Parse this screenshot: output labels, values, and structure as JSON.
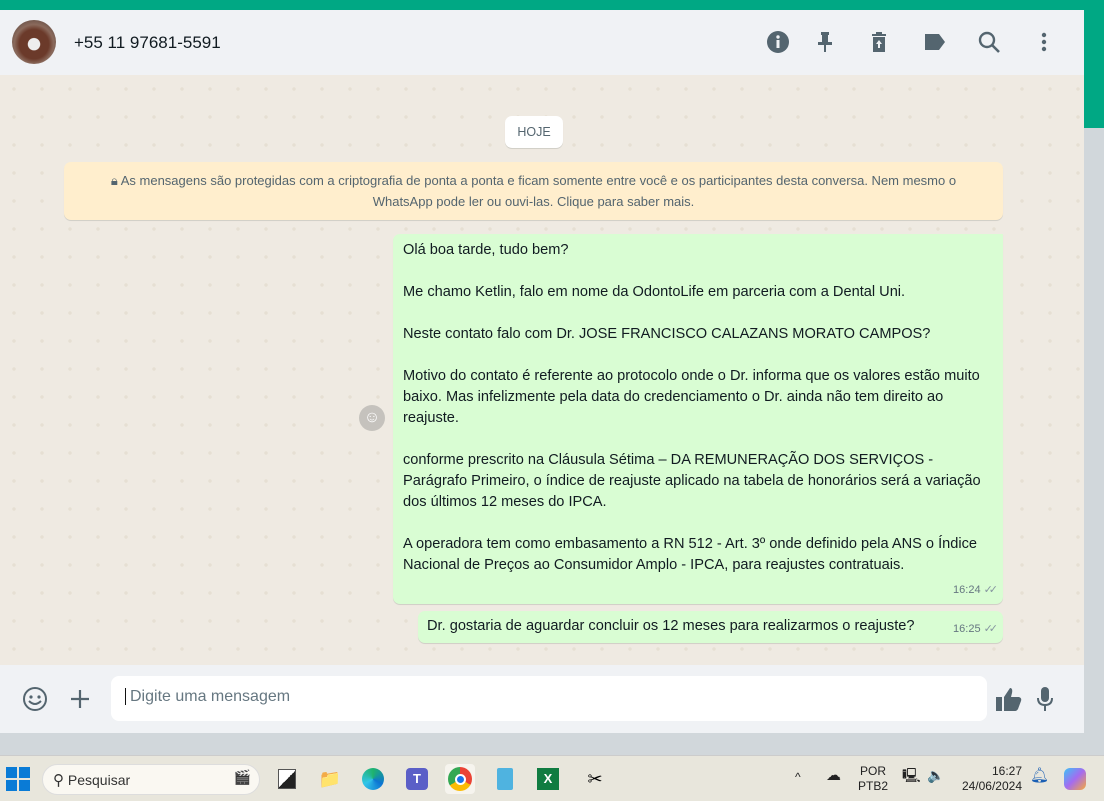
{
  "header": {
    "contact": "+55 11 97681-5591"
  },
  "chat": {
    "date_pill": "HOJE",
    "encryption_notice": "As mensagens são protegidas com a criptografia de ponta a ponta e ficam somente entre você e os participantes desta conversa. Nem mesmo o WhatsApp pode ler ou ouvi-las. Clique para saber mais.",
    "messages": [
      {
        "lines": [
          "Olá boa tarde, tudo bem?",
          "",
          "Me chamo Ketlin, falo em nome da OdontoLife em parceria com a Dental Uni.",
          "",
          "Neste contato falo com Dr. JOSE FRANCISCO CALAZANS MORATO CAMPOS?",
          "",
          "Motivo do contato é referente ao protocolo onde o Dr. informa que os valores estão muito baixo. Mas infelizmente pela data do credenciamento o Dr. ainda não tem direito ao reajuste.",
          "",
          "conforme prescrito na Cláusula Sétima – DA REMUNERAÇÃO DOS SERVIÇOS - Parágrafo Primeiro, o índice de reajuste aplicado na tabela de honorários será a variação dos últimos 12 meses do IPCA.",
          "",
          "A operadora tem como embasamento a RN 512 - Art. 3º onde definido pela ANS o Índice Nacional de Preços ao Consumidor Amplo - IPCA, para reajustes contratuais."
        ],
        "time": "16:24"
      },
      {
        "text": "Dr. gostaria de aguardar concluir os 12 meses para realizarmos o reajuste?",
        "time": "16:25"
      }
    ]
  },
  "composer": {
    "placeholder": "Digite uma mensagem"
  },
  "taskbar": {
    "search": "Pesquisar",
    "lang1": "POR",
    "lang2": "PTB2",
    "time": "16:27",
    "date": "24/06/2024"
  }
}
